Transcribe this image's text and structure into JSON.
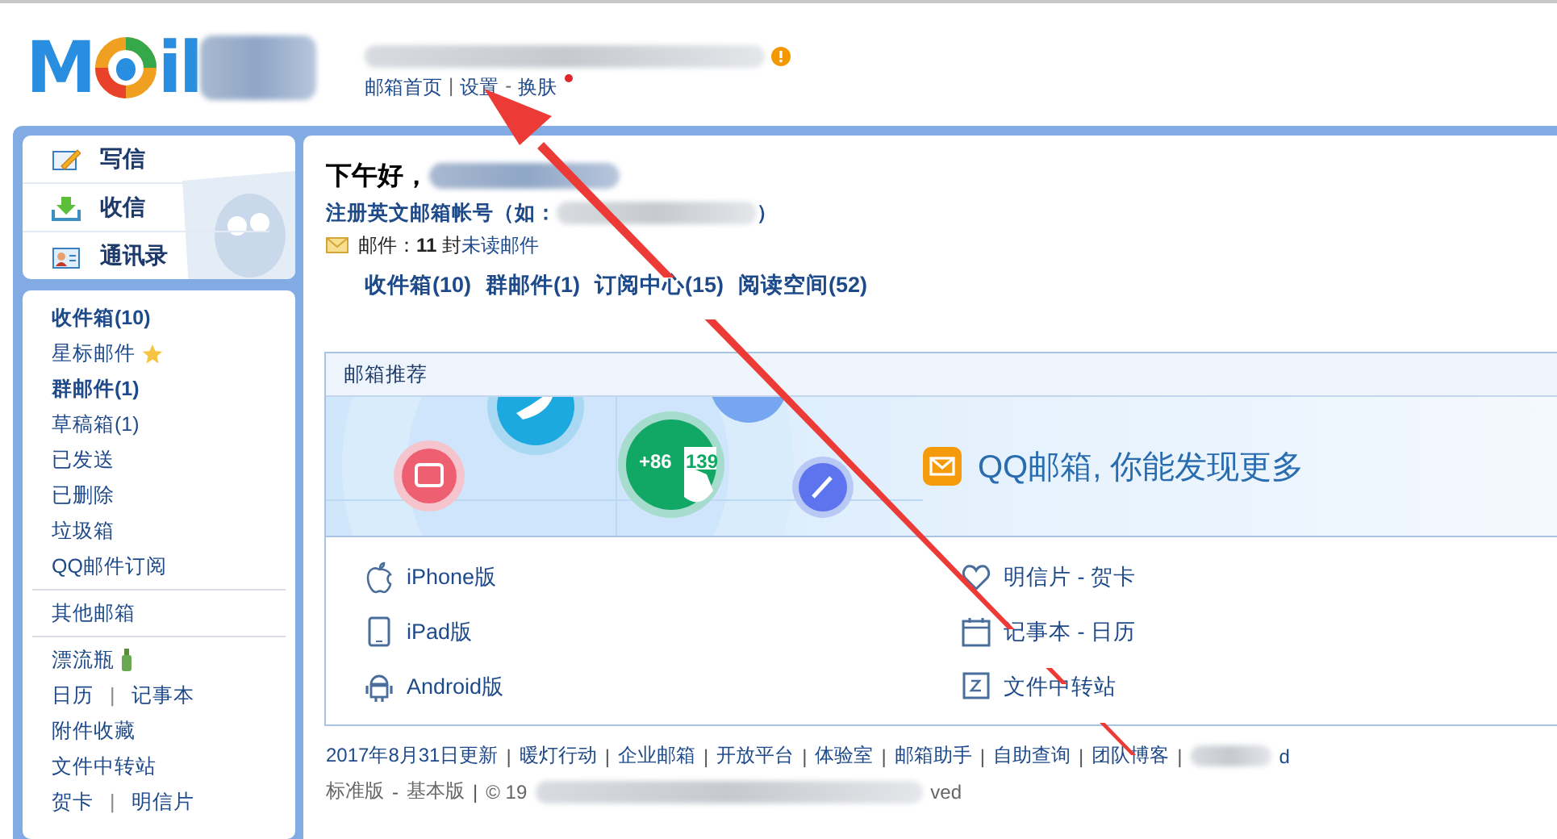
{
  "logo": {
    "before": "M",
    "after": "il"
  },
  "header": {
    "links": [
      {
        "kind": "link",
        "label": "邮箱首页",
        "new": false
      },
      {
        "kind": "sep",
        "label": "|"
      },
      {
        "kind": "link",
        "label": "设置",
        "new": false
      },
      {
        "kind": "sep",
        "label": "-"
      },
      {
        "kind": "link",
        "label": "换肤",
        "new": true
      }
    ]
  },
  "actions": [
    {
      "kind": "compose",
      "label": "写信"
    },
    {
      "kind": "receive",
      "label": "收信"
    },
    {
      "kind": "contacts",
      "label": "通讯录"
    }
  ],
  "sidebar": {
    "groups": [
      [
        {
          "kind": "folder",
          "parts": [
            "收件箱(10)"
          ],
          "unread": true
        },
        {
          "kind": "starred",
          "parts": [
            "星标邮件"
          ],
          "unread": false
        },
        {
          "kind": "folder",
          "parts": [
            "群邮件(1)"
          ],
          "unread": true
        },
        {
          "kind": "folder",
          "parts": [
            "草稿箱(1)"
          ],
          "unread": false
        },
        {
          "kind": "folder",
          "parts": [
            "已发送"
          ],
          "unread": false
        },
        {
          "kind": "folder",
          "parts": [
            "已删除"
          ],
          "unread": false
        },
        {
          "kind": "folder",
          "parts": [
            "垃圾箱"
          ],
          "unread": false
        },
        {
          "kind": "folder",
          "parts": [
            "QQ邮件订阅"
          ],
          "unread": false
        }
      ],
      [
        {
          "kind": "folder",
          "parts": [
            "其他邮箱"
          ],
          "unread": false
        }
      ],
      [
        {
          "kind": "bottle",
          "parts": [
            "漂流瓶"
          ],
          "unread": false
        },
        {
          "kind": "folder",
          "parts": [
            "日历",
            "|",
            "记事本"
          ],
          "unread": false
        },
        {
          "kind": "folder",
          "parts": [
            "附件收藏"
          ],
          "unread": false
        },
        {
          "kind": "folder",
          "parts": [
            "文件中转站"
          ],
          "unread": false
        },
        {
          "kind": "folder",
          "parts": [
            "贺卡",
            "|",
            "明信片"
          ],
          "unread": false
        }
      ]
    ]
  },
  "welcome": {
    "greeting": "下午好，",
    "register": "注册英文邮箱帐号（如：",
    "register_end": "）",
    "mail_count": "邮件：**11** 封",
    "unread_link": "未读邮件"
  },
  "quick_links": [
    "收件箱(10)",
    "群邮件(1)",
    "订阅中心(15)",
    "阅读空间(52)"
  ],
  "recommend": {
    "title": "邮箱推荐",
    "banner_number": "+86",
    "banner_digits": "139",
    "banner_text": "QQ邮箱, 你能发现更多",
    "links": [
      {
        "kind": "apple",
        "label": "iPhone版"
      },
      {
        "kind": "heart",
        "label": "明信片 - 贺卡"
      },
      {
        "kind": "tablet",
        "label": "iPad版"
      },
      {
        "kind": "calendar",
        "label": "记事本 - 日历"
      },
      {
        "kind": "android",
        "label": "Android版"
      },
      {
        "kind": "transfer",
        "label": "文件中转站"
      }
    ]
  },
  "footer": {
    "links": [
      "2017年8月31日更新",
      "暖灯行动",
      "企业邮箱",
      "开放平台",
      "体验室",
      "邮箱助手",
      "自助查询",
      "团队博客"
    ],
    "sep": "|",
    "tail": "d",
    "versions": [
      "标准版",
      "-",
      "基本版",
      "|"
    ],
    "copyright": "© 19",
    "copyright_end": "ved"
  }
}
